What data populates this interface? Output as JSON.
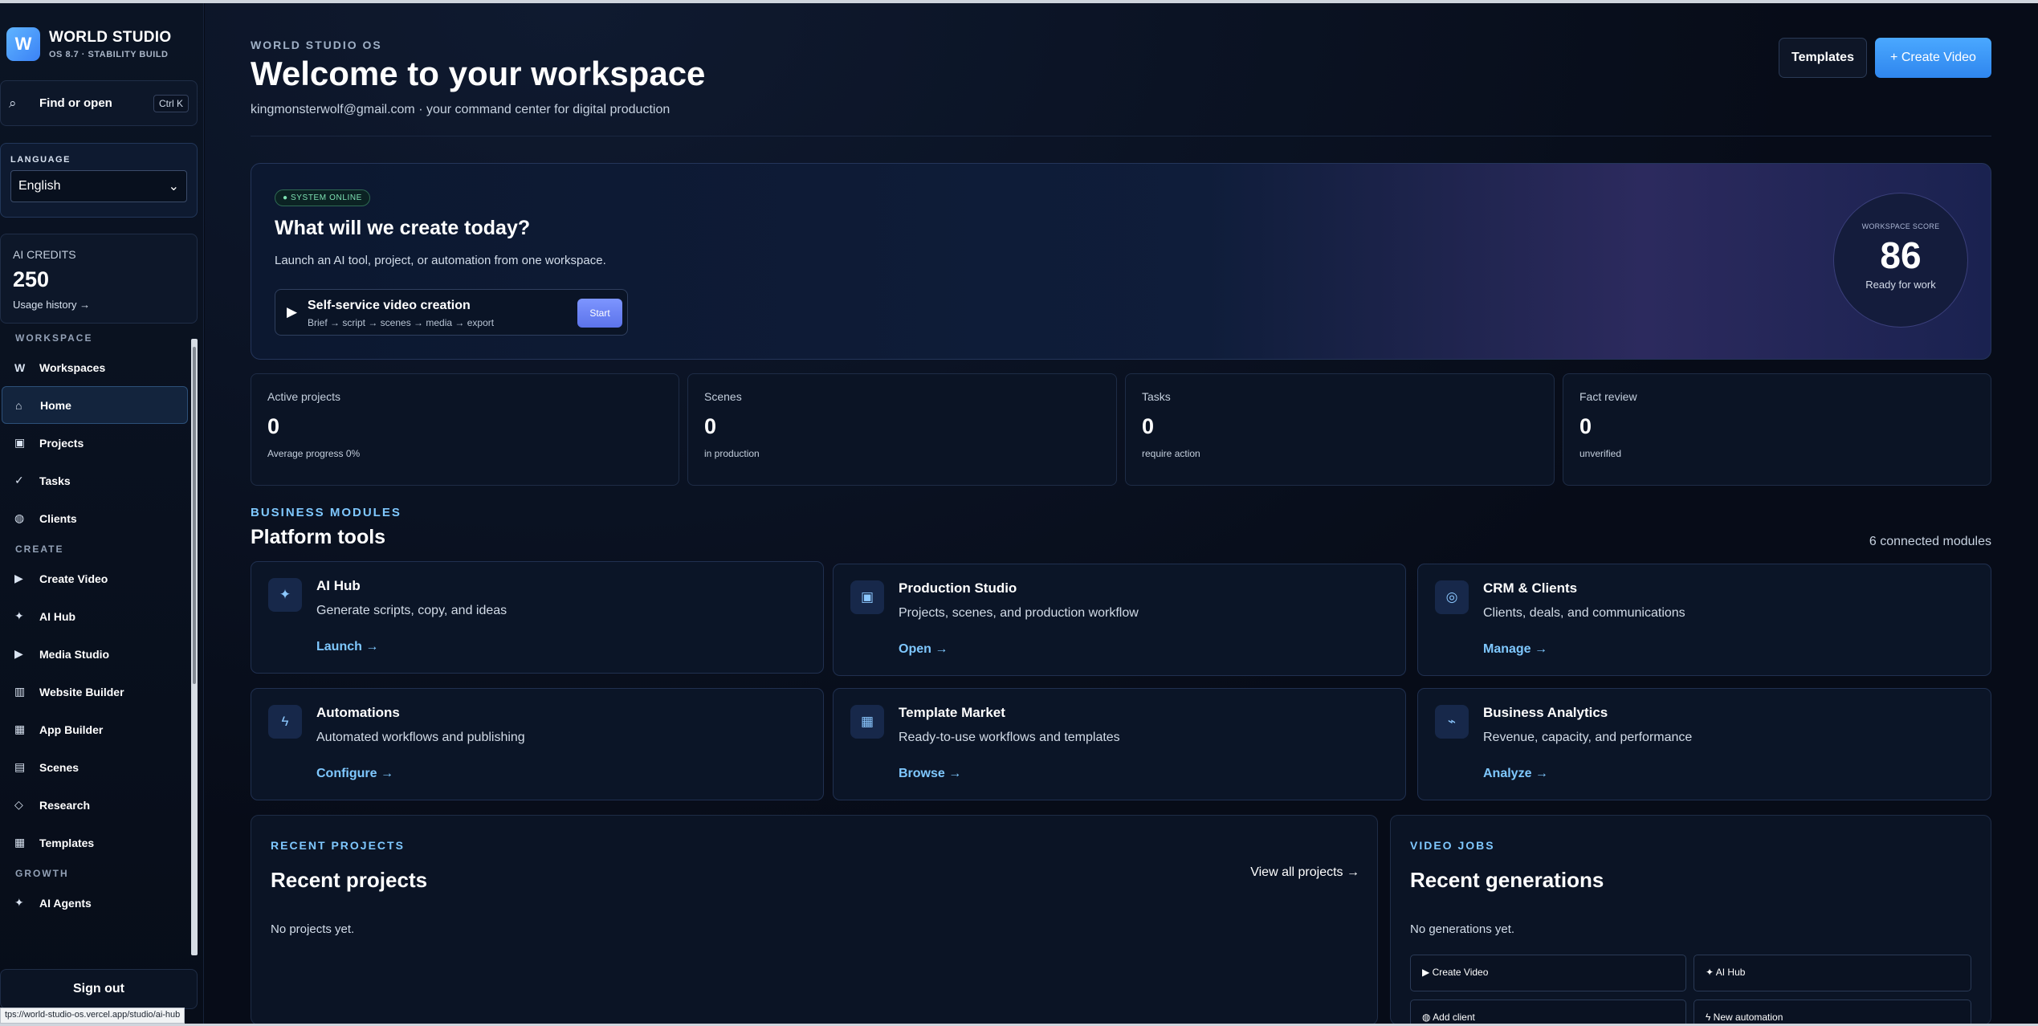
{
  "brand": {
    "title": "WORLD STUDIO",
    "subtitle": "OS 8.7 · STABILITY BUILD",
    "logo_letter": "W"
  },
  "find": {
    "label": "Find or open",
    "shortcut": "Ctrl K",
    "icon": "search-icon"
  },
  "language": {
    "caption": "LANGUAGE",
    "selected": "English",
    "arrow": "⌄"
  },
  "credits": {
    "caption": "AI CREDITS",
    "value": "250",
    "link": "Usage history →"
  },
  "nav": {
    "workspace_label": "WORKSPACE",
    "workspace_items": [
      {
        "icon": "W",
        "label": "Workspaces"
      },
      {
        "icon": "⌂",
        "label": "Home"
      },
      {
        "icon": "▣",
        "label": "Projects"
      },
      {
        "icon": "✓",
        "label": "Tasks"
      },
      {
        "icon": "◍",
        "label": "Clients"
      }
    ],
    "create_label": "CREATE",
    "create_items": [
      {
        "icon": "▶",
        "label": "Create Video"
      },
      {
        "icon": "✦",
        "label": "AI Hub"
      },
      {
        "icon": "▶",
        "label": "Media Studio"
      },
      {
        "icon": "▥",
        "label": "Website Builder"
      },
      {
        "icon": "▦",
        "label": "App Builder"
      },
      {
        "icon": "▤",
        "label": "Scenes"
      },
      {
        "icon": "◇",
        "label": "Research"
      },
      {
        "icon": "▦",
        "label": "Templates"
      }
    ],
    "growth_label": "GROWTH",
    "growth_items": [
      {
        "icon": "✦",
        "label": "AI Agents"
      }
    ]
  },
  "signout": "Sign out",
  "status_url": "tps://world-studio-os.vercel.app/studio/ai-hub",
  "header": {
    "eyebrow": "WORLD STUDIO OS",
    "title": "Welcome to your workspace",
    "subtitle": "kingmonsterwolf@gmail.com · your command center for digital production",
    "templates_btn": "Templates",
    "create_btn": "+ Create Video"
  },
  "hero": {
    "pill": "● SYSTEM ONLINE",
    "title": "What will we create today?",
    "subtitle": "Launch an AI tool, project, or automation from one workspace.",
    "service_title": "Self-service video creation",
    "service_sub": "Brief → script → scenes → media → export",
    "start": "Start",
    "score_caption": "WORKSPACE SCORE",
    "score": "86",
    "score_status": "Ready for work"
  },
  "stats": [
    {
      "label": "Active projects",
      "value": "0",
      "detail": "Average progress 0%"
    },
    {
      "label": "Scenes",
      "value": "0",
      "detail": "in production"
    },
    {
      "label": "Tasks",
      "value": "0",
      "detail": "require action"
    },
    {
      "label": "Fact review",
      "value": "0",
      "detail": "unverified"
    }
  ],
  "modules": {
    "eyebrow": "BUSINESS MODULES",
    "title": "Platform tools",
    "count": "6 connected modules",
    "items": [
      {
        "icon": "✦",
        "title": "AI Hub",
        "desc": "Generate scripts, copy, and ideas",
        "link": "Launch →"
      },
      {
        "icon": "▣",
        "title": "Production Studio",
        "desc": "Projects, scenes, and production workflow",
        "link": "Open →"
      },
      {
        "icon": "◎",
        "title": "CRM & Clients",
        "desc": "Clients, deals, and communications",
        "link": "Manage →"
      },
      {
        "icon": "ϟ",
        "title": "Automations",
        "desc": "Automated workflows and publishing",
        "link": "Configure →"
      },
      {
        "icon": "▦",
        "title": "Template Market",
        "desc": "Ready-to-use workflows and templates",
        "link": "Browse →"
      },
      {
        "icon": "⌁",
        "title": "Business Analytics",
        "desc": "Revenue, capacity, and performance",
        "link": "Analyze →"
      }
    ]
  },
  "recent_projects": {
    "eyebrow": "RECENT PROJECTS",
    "title": "Recent projects",
    "view_all": "View all projects →",
    "empty": "No projects yet."
  },
  "video_jobs": {
    "eyebrow": "VIDEO JOBS",
    "title": "Recent generations",
    "empty": "No generations yet.",
    "actions": [
      "▶ Create Video",
      "✦ AI Hub",
      "◍ Add client",
      "ϟ New automation"
    ]
  }
}
